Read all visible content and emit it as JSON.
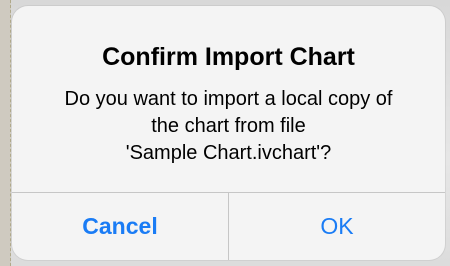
{
  "dialog": {
    "title": "Confirm Import Chart",
    "message_lines": [
      "Do you want to import a local copy of",
      "the chart from file",
      "'Sample Chart.ivchart'?"
    ],
    "cancel_label": "Cancel",
    "ok_label": "OK"
  },
  "colors": {
    "accent": "#1a7cf5",
    "dialog_bg": "#f4f4f4",
    "divider": "#c6c6c6"
  }
}
